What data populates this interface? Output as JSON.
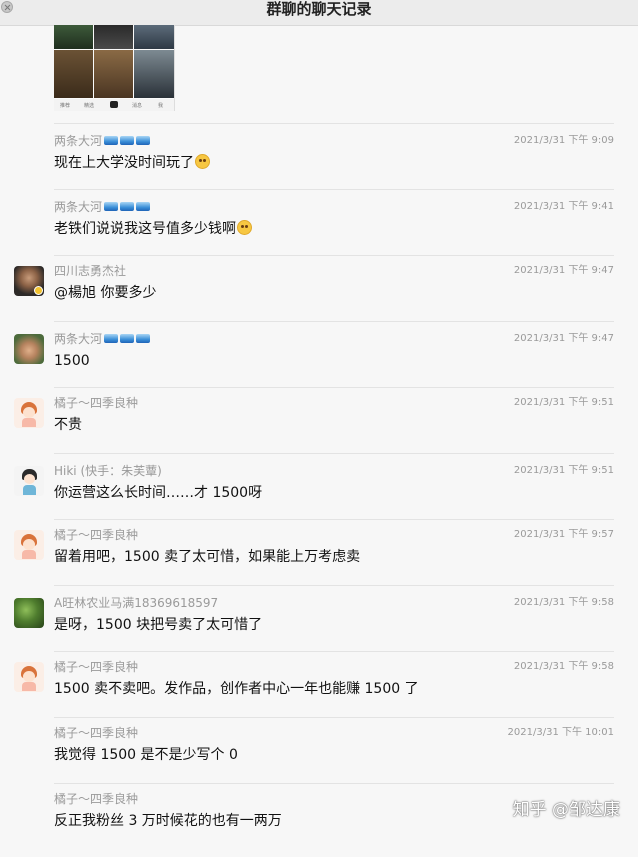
{
  "window": {
    "title": "群聊的聊天记录"
  },
  "thumbnail": {
    "tabs": [
      "推荐",
      "精选",
      "",
      "消息",
      "我"
    ]
  },
  "messages": [
    {
      "name": "两条大河",
      "time": "2021/3/31 下午 9:09",
      "text": "现在上大学没时间玩了",
      "emoji": "flushed-face",
      "waves": 3,
      "avatar": "none"
    },
    {
      "name": "两条大河",
      "time": "2021/3/31 下午 9:41",
      "text": "老铁们说说我这号值多少钱啊",
      "emoji": "zany-face",
      "waves": 3,
      "avatar": "none"
    },
    {
      "name": "四川志勇杰社",
      "time": "2021/3/31 下午 9:47",
      "text": "@楊旭 你要多少",
      "emoji": "",
      "waves": 0,
      "avatar": "man-photo"
    },
    {
      "name": "两条大河",
      "time": "2021/3/31 下午 9:47",
      "text": "1500",
      "emoji": "",
      "waves": 3,
      "avatar": "kid-photo"
    },
    {
      "name": "橘子～四季良种",
      "time": "2021/3/31 下午 9:51",
      "text": "不贵",
      "emoji": "",
      "waves": 0,
      "avatar": "cartoon-girl"
    },
    {
      "name": "Hiki (快手：朱芙蕈)",
      "time": "2021/3/31 下午 9:51",
      "text": "你运营这么长时间……才 1500呀",
      "emoji": "",
      "waves": 0,
      "avatar": "cartoon-boy"
    },
    {
      "name": "橘子～四季良种",
      "time": "2021/3/31 下午 9:57",
      "text": "留着用吧，1500 卖了太可惜，如果能上万考虑卖",
      "emoji": "",
      "waves": 0,
      "avatar": "cartoon-girl"
    },
    {
      "name": "A旺林农业马满18369618597",
      "time": "2021/3/31 下午 9:58",
      "text": "是呀，1500 块把号卖了太可惜了",
      "emoji": "",
      "waves": 0,
      "avatar": "plant-photo"
    },
    {
      "name": "橘子～四季良种",
      "time": "2021/3/31 下午 9:58",
      "text": "1500 卖不卖吧。发作品，创作者中心一年也能赚 1500 了",
      "emoji": "",
      "waves": 0,
      "avatar": "cartoon-girl"
    },
    {
      "name": "橘子～四季良种",
      "time": "2021/3/31 下午 10:01",
      "text": "我觉得 1500 是不是少写个 0",
      "emoji": "",
      "waves": 0,
      "avatar": "none"
    },
    {
      "name": "橘子～四季良种",
      "time": "",
      "text": "反正我粉丝 3 万时候花的也有一两万",
      "emoji": "",
      "waves": 0,
      "avatar": "none"
    }
  ],
  "watermark": "知乎 @邹达康",
  "colors": {
    "background": "#f7f7f7",
    "meta_text": "#9a9a9a",
    "separator": "#e3e3e3"
  }
}
